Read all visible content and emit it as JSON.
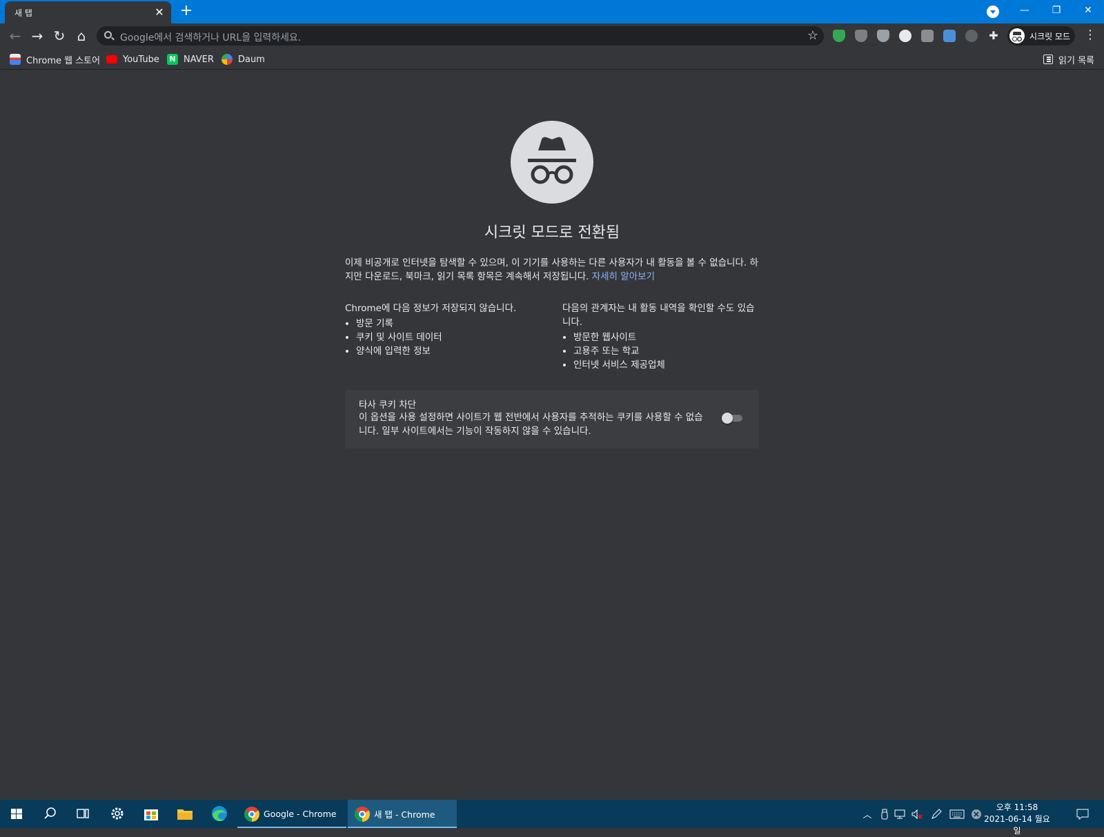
{
  "tab": {
    "title": "새 탭"
  },
  "omnibox": {
    "placeholder": "Google에서 검색하거나 URL을 입력하세요."
  },
  "profile": {
    "label": "시크릿 모드"
  },
  "bookmarks": [
    {
      "label": "Chrome 웹 스토어",
      "icon": "chrome-web-store-icon",
      "color": "#e8eaed"
    },
    {
      "label": "YouTube",
      "icon": "youtube-icon",
      "color": "#ff0000"
    },
    {
      "label": "NAVER",
      "icon": "naver-icon",
      "color": "#03c75a"
    },
    {
      "label": "Daum",
      "icon": "daum-icon",
      "color": "#f2b134"
    }
  ],
  "reading_list": {
    "label": "읽기 목록"
  },
  "incognito": {
    "title": "시크릿 모드로 전환됨",
    "intro": "이제 비공개로 인터넷을 탐색할 수 있으며, 이 기기를 사용하는 다른 사용자가 내 활동을 볼 수 없습니다. 하지만 다운로드, 북마크, 읽기 목록 항목은 계속해서 저장됩니다.",
    "learn_more": "자세히 알아보기",
    "not_saved_heading": "Chrome에 다음 정보가 저장되지 않습니다.",
    "not_saved": [
      "방문 기록",
      "쿠키 및 사이트 데이터",
      "양식에 입력한 정보"
    ],
    "visible_heading": "다음의 관계자는 내 활동 내역을 확인할 수도 있습니다.",
    "visible_to": [
      "방문한 웹사이트",
      "고용주 또는 학교",
      "인터넷 서비스 제공업체"
    ],
    "cookie_title": "타사 쿠키 차단",
    "cookie_desc": "이 옵션을 사용 설정하면 사이트가 웹 전반에서 사용자를 추적하는 쿠키를 사용할 수 없습니다. 일부 사이트에서는 기능이 작동하지 않을 수 있습니다.",
    "cookie_toggle_on": false
  },
  "taskbar": {
    "apps": [
      {
        "label": "Google - Chrome"
      },
      {
        "label": "새 탭 - Chrome"
      }
    ],
    "clock_time": "오후 11:58",
    "clock_date": "2021-06-14 월요일"
  },
  "colors": {
    "titlebar": "#0078d7",
    "page_bg": "#35363a",
    "link": "#8ab4f8",
    "taskbar": "#083a5a"
  }
}
